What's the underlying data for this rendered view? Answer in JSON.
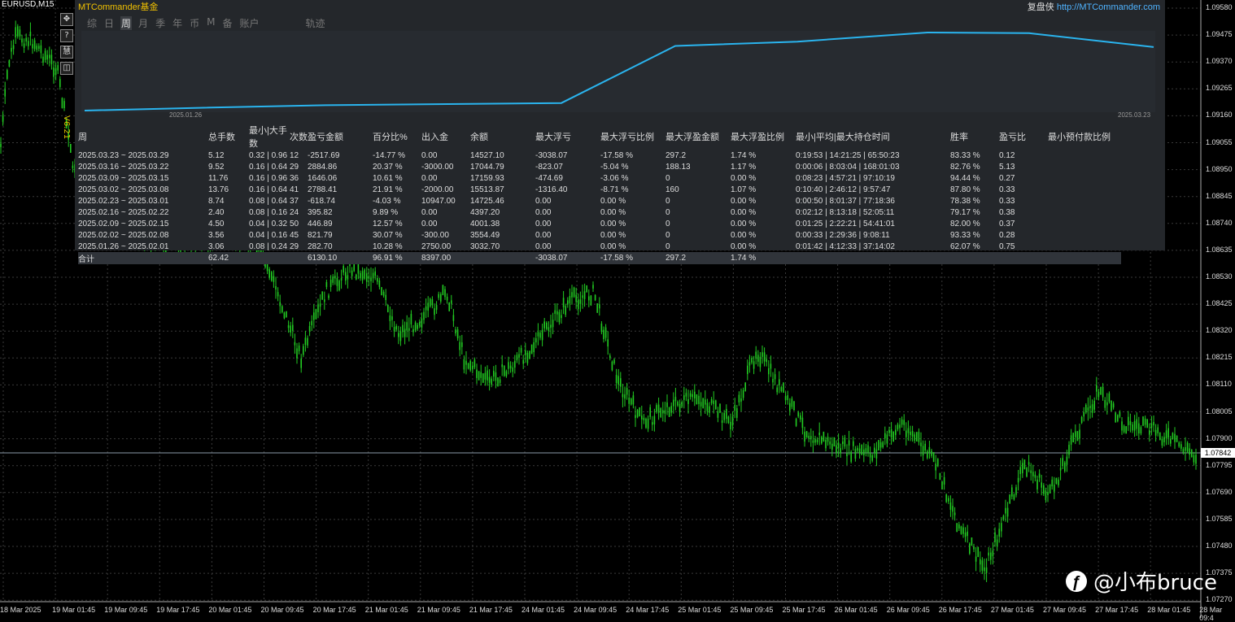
{
  "chart": {
    "symbol": "EURUSD,M15",
    "current_price": "1.07842",
    "colors": {
      "bull": "#22cc22",
      "grid": "#3a3a3a",
      "bg": "#000000",
      "price_line": "#8a9aa8"
    },
    "price_labels": [
      "1.09580",
      "1.09475",
      "1.09370",
      "1.09265",
      "1.09160",
      "1.09055",
      "1.08950",
      "1.08845",
      "1.08740",
      "1.08635",
      "1.08530",
      "1.08425",
      "1.08320",
      "1.08215",
      "1.08110",
      "1.08005",
      "1.07900",
      "1.07795",
      "1.07690",
      "1.07585",
      "1.07480",
      "1.07375",
      "1.07270"
    ],
    "time_labels": [
      "18 Mar 2025",
      "19 Mar 01:45",
      "19 Mar 09:45",
      "19 Mar 17:45",
      "20 Mar 01:45",
      "20 Mar 09:45",
      "20 Mar 17:45",
      "21 Mar 01:45",
      "21 Mar 09:45",
      "21 Mar 17:45",
      "24 Mar 01:45",
      "24 Mar 09:45",
      "24 Mar 17:45",
      "25 Mar 01:45",
      "25 Mar 09:45",
      "25 Mar 17:45",
      "26 Mar 01:45",
      "26 Mar 09:45",
      "26 Mar 17:45",
      "27 Mar 01:45",
      "27 Mar 09:45",
      "27 Mar 17:45",
      "28 Mar 01:45",
      "28 Mar 09:4"
    ],
    "tools": [
      "move-icon",
      "help-icon",
      "pin-icon",
      "window-icon"
    ],
    "tool_glyphs": [
      "✥",
      "?",
      "慧",
      "◫"
    ],
    "version": "V6.21"
  },
  "panel": {
    "title": "MTCommander基金",
    "link_prefix": "复盘侠 ",
    "link_url": "http://MTCommander.com",
    "tabs": [
      {
        "label": "综",
        "active": false
      },
      {
        "label": "日",
        "active": false
      },
      {
        "label": "周",
        "active": true
      },
      {
        "label": "月",
        "active": false
      },
      {
        "label": "季",
        "active": false
      },
      {
        "label": "年",
        "active": false
      },
      {
        "label": "币",
        "active": false
      },
      {
        "label": "M",
        "active": false
      },
      {
        "label": "备",
        "active": false
      },
      {
        "label": "账户",
        "active": false
      },
      {
        "label": "轨迹",
        "active": false
      }
    ],
    "equity": {
      "start_label": "2025.01.26",
      "end_label": "2025.03.23",
      "values": [
        3032.7,
        3554.49,
        4001.38,
        4397.2,
        14725.46,
        15513.87,
        17159.93,
        17044.79,
        14527.1
      ],
      "line_color": "#2ab4ee"
    },
    "columns": [
      "周",
      "总手数",
      "最小|大手数",
      "次数",
      "盈亏金额",
      "百分比%",
      "出入金",
      "余额",
      "最大浮亏",
      "最大浮亏比例",
      "最大浮盈金额",
      "最大浮盈比例",
      "最小|平均|最大持仓时间",
      "胜率",
      "盈亏比",
      "最小预付款比例"
    ],
    "rows": [
      {
        "cells": [
          "2025.03.23 ~ 2025.03.29",
          "5.12",
          "0.32 | 0.96",
          "12",
          "-2517.69",
          "-14.77 %",
          "0.00",
          "14527.10",
          "-3038.07",
          "-17.58 %",
          "297.2",
          "1.74 %",
          "0:19:53 | 14:21:25 | 65:50:23",
          "83.33 %",
          "0.12",
          ""
        ],
        "colors": [
          "w",
          "g",
          "g",
          "g",
          "g",
          "g",
          "w",
          "w",
          "g",
          "g",
          "r",
          "r",
          "w",
          "w",
          "w",
          "w"
        ]
      },
      {
        "cells": [
          "2025.03.16 ~ 2025.03.22",
          "9.52",
          "0.16 | 0.64",
          "29",
          "2884.86",
          "20.37 %",
          "-3000.00",
          "17044.79",
          "-823.07",
          "-5.04 %",
          "188.13",
          "1.17 %",
          "0:00:06 | 8:03:04 | 168:01:03",
          "82.76 %",
          "5.13",
          ""
        ],
        "colors": [
          "w",
          "r",
          "r",
          "r",
          "r",
          "r",
          "g",
          "w",
          "g",
          "g",
          "r",
          "r",
          "w",
          "w",
          "w",
          "w"
        ]
      },
      {
        "cells": [
          "2025.03.09 ~ 2025.03.15",
          "11.76",
          "0.16 | 0.96",
          "36",
          "1646.06",
          "10.61 %",
          "0.00",
          "17159.93",
          "-474.69",
          "-3.06 %",
          "0",
          "0.00 %",
          "0:08:23 | 4:57:21 | 97:10:19",
          "94.44 %",
          "0.27",
          ""
        ],
        "colors": [
          "w",
          "r",
          "r",
          "r",
          "r",
          "r",
          "w",
          "w",
          "g",
          "g",
          "w",
          "w",
          "w",
          "w",
          "w",
          "w"
        ]
      },
      {
        "cells": [
          "2025.03.02 ~ 2025.03.08",
          "13.76",
          "0.16 | 0.64",
          "41",
          "2788.41",
          "21.91 %",
          "-2000.00",
          "15513.87",
          "-1316.40",
          "-8.71 %",
          "160",
          "1.07 %",
          "0:10:40 | 2:46:12 | 9:57:47",
          "87.80 %",
          "0.33",
          ""
        ],
        "colors": [
          "w",
          "r",
          "r",
          "r",
          "r",
          "r",
          "g",
          "w",
          "g",
          "g",
          "r",
          "r",
          "w",
          "w",
          "w",
          "w"
        ]
      },
      {
        "cells": [
          "2025.02.23 ~ 2025.03.01",
          "8.74",
          "0.08 | 0.64",
          "37",
          "-618.74",
          "-4.03 %",
          "10947.00",
          "14725.46",
          "0.00",
          "0.00 %",
          "0",
          "0.00 %",
          "0:00:50 | 8:01:37 | 77:18:36",
          "78.38 %",
          "0.33",
          ""
        ],
        "colors": [
          "w",
          "g",
          "g",
          "g",
          "g",
          "g",
          "r",
          "w",
          "w",
          "w",
          "w",
          "w",
          "w",
          "w",
          "w",
          "w"
        ]
      },
      {
        "cells": [
          "2025.02.16 ~ 2025.02.22",
          "2.40",
          "0.08 | 0.16",
          "24",
          "395.82",
          "9.89 %",
          "0.00",
          "4397.20",
          "0.00",
          "0.00 %",
          "0",
          "0.00 %",
          "0:02:12 | 8:13:18 | 52:05:11",
          "79.17 %",
          "0.38",
          ""
        ],
        "colors": [
          "w",
          "r",
          "r",
          "r",
          "r",
          "r",
          "w",
          "w",
          "w",
          "w",
          "w",
          "w",
          "w",
          "w",
          "w",
          "w"
        ]
      },
      {
        "cells": [
          "2025.02.09 ~ 2025.02.15",
          "4.50",
          "0.04 | 0.32",
          "50",
          "446.89",
          "12.57 %",
          "0.00",
          "4001.38",
          "0.00",
          "0.00 %",
          "0",
          "0.00 %",
          "0:01:25 | 2:22:21 | 54:41:01",
          "82.00 %",
          "0.37",
          ""
        ],
        "colors": [
          "w",
          "r",
          "r",
          "r",
          "r",
          "r",
          "w",
          "w",
          "w",
          "w",
          "w",
          "w",
          "w",
          "w",
          "w",
          "w"
        ]
      },
      {
        "cells": [
          "2025.02.02 ~ 2025.02.08",
          "3.56",
          "0.04 | 0.16",
          "45",
          "821.79",
          "30.07 %",
          "-300.00",
          "3554.49",
          "0.00",
          "0.00 %",
          "0",
          "0.00 %",
          "0:00:33 | 2:29:36 | 9:08:11",
          "93.33 %",
          "0.28",
          ""
        ],
        "colors": [
          "w",
          "r",
          "r",
          "r",
          "r",
          "r",
          "g",
          "w",
          "w",
          "w",
          "w",
          "w",
          "w",
          "w",
          "w",
          "w"
        ]
      },
      {
        "cells": [
          "2025.01.26 ~ 2025.02.01",
          "3.06",
          "0.08 | 0.24",
          "29",
          "282.70",
          "10.28 %",
          "2750.00",
          "3032.70",
          "0.00",
          "0.00 %",
          "0",
          "0.00 %",
          "0:01:42 | 4:12:33 | 37:14:02",
          "62.07 %",
          "0.75",
          ""
        ],
        "colors": [
          "w",
          "r",
          "r",
          "r",
          "r",
          "r",
          "r",
          "w",
          "w",
          "w",
          "w",
          "w",
          "w",
          "w",
          "w",
          "w"
        ]
      }
    ],
    "total": {
      "cells": [
        "合计",
        "62.42",
        "",
        "",
        "6130.10",
        "96.91 %",
        "8397.00",
        "",
        "-3038.07",
        "-17.58 %",
        "297.2",
        "1.74 %",
        "",
        "",
        "",
        ""
      ],
      "colors": [
        "w",
        "r",
        "w",
        "w",
        "r",
        "r",
        "r",
        "w",
        "g",
        "g",
        "r",
        "r",
        "w",
        "w",
        "w",
        "w"
      ]
    }
  },
  "watermark": {
    "icon_glyph": "ƒ",
    "text": "@小布bruce"
  }
}
